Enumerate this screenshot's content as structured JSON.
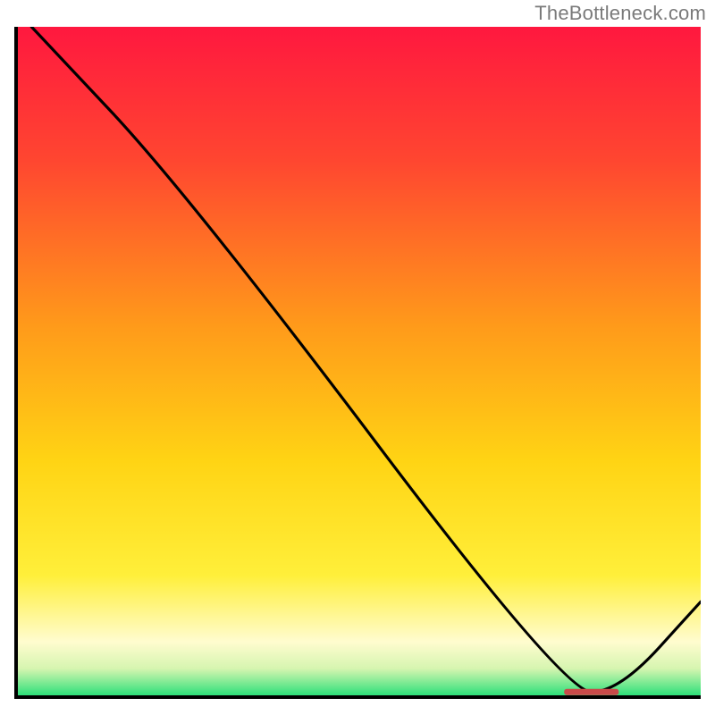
{
  "watermark": "TheBottleneck.com",
  "chart_data": {
    "type": "line",
    "title": "",
    "xlabel": "",
    "ylabel": "",
    "xlim": [
      0,
      100
    ],
    "ylim": [
      0,
      100
    ],
    "line": {
      "x": [
        2,
        25,
        80,
        88,
        100
      ],
      "y": [
        100,
        75,
        0.5,
        0.5,
        14
      ]
    },
    "minimum_marker": {
      "x_start": 80,
      "x_end": 88,
      "y": 0.5,
      "color": "#c94a4a"
    },
    "gradient_stops": [
      {
        "offset": 0,
        "color": "#ff183f"
      },
      {
        "offset": 20,
        "color": "#ff4630"
      },
      {
        "offset": 45,
        "color": "#ff9b1a"
      },
      {
        "offset": 65,
        "color": "#ffd414"
      },
      {
        "offset": 82,
        "color": "#ffef3a"
      },
      {
        "offset": 92,
        "color": "#fffccf"
      },
      {
        "offset": 96,
        "color": "#d6f5b0"
      },
      {
        "offset": 100,
        "color": "#2ee07a"
      }
    ]
  }
}
